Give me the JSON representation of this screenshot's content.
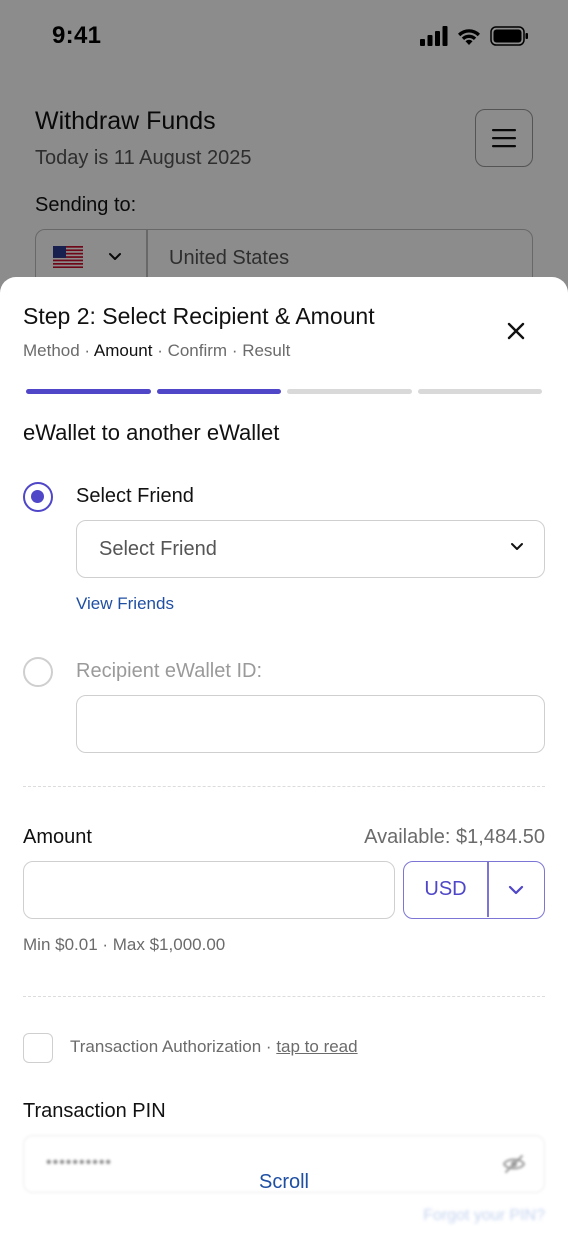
{
  "status_bar": {
    "time": "9:41"
  },
  "background": {
    "title": "Withdraw Funds",
    "date": "Today is 11 August 2025",
    "sending_label": "Sending to:",
    "country": "United States"
  },
  "sheet": {
    "title": "Step 2: Select Recipient & Amount",
    "steps": [
      "Method",
      "Amount",
      "Confirm",
      "Result"
    ],
    "active_step": "Amount",
    "progress": {
      "completed": 2,
      "total": 4
    },
    "section_title": "eWallet to another eWallet",
    "recipient": {
      "select_friend_label": "Select Friend",
      "select_friend_placeholder": "Select Friend",
      "view_friends": "View Friends",
      "ewallet_id_label": "Recipient eWallet ID:",
      "ewallet_id_value": "",
      "selected_option": "Select Friend"
    },
    "amount": {
      "label": "Amount",
      "available": "Available: $1,484.50",
      "value": "",
      "currency": "USD",
      "limits": "Min $0.01 · Max $1,000.00"
    },
    "authorization": {
      "text": "Transaction Authorization · ",
      "link": "tap to read",
      "checked": false
    },
    "pin": {
      "label": "Transaction PIN",
      "masked_value": "••••••••••",
      "forgot": "Forgot your PIN?"
    },
    "scroll_hint": "Scroll"
  },
  "colors": {
    "accent": "#4f46c8",
    "link": "#1f4fa3",
    "overlay": "rgba(0,0,0,0.45)"
  },
  "icons": {
    "close": "close-icon",
    "chevron": "chevron-down-icon",
    "menu": "menu-icon",
    "eye": "eye-off-icon",
    "flag": "us-flag-icon"
  }
}
